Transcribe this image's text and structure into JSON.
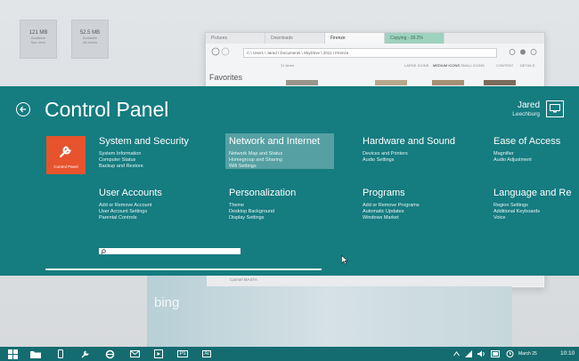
{
  "desktop": {
    "items": [
      {
        "size": "121 MB",
        "sub1": "Available",
        "sub2": "Sys drive"
      },
      {
        "size": "52.5 MB",
        "sub1": "Available",
        "sub2": "All drives"
      }
    ]
  },
  "explorer": {
    "tabs": [
      "Pictures",
      "Downloads",
      "Firenze",
      "Copying - 39.2%"
    ],
    "address": "C:\\ Users \\ Jared \\ Documents \\ SkyDrive \\ 2011 \\ Firenze",
    "favorites_label": "Favorites",
    "item_count": "31 items",
    "view_options": [
      "LARGE ICONS",
      "MEDIUM ICONS",
      "SMALL ICONS",
      "CONTENT",
      "DETAILS"
    ],
    "bing_label": "bing",
    "sidebar_item": "Carmel MASTA"
  },
  "control_panel": {
    "title": "Control Panel",
    "user_name": "Jared",
    "user_location": "Leechburg",
    "tile_label": "Control Panel",
    "categories": [
      {
        "title": "System and Security",
        "links": [
          "System Information",
          "Computer Status",
          "Backup and Restore"
        ]
      },
      {
        "title": "Network and Internet",
        "links": [
          "Network Map and Status",
          "Homegroup and Sharing",
          "Wifi Settings"
        ]
      },
      {
        "title": "Hardware and Sound",
        "links": [
          "Devices and Printers",
          "Audio Settings"
        ]
      },
      {
        "title": "Ease of Access",
        "links": [
          "Magnifier",
          "Audio Adjustment"
        ]
      },
      {
        "title": "User Accounts",
        "links": [
          "Add or Remove Account",
          "User Account Settings",
          "Parental Controls"
        ]
      },
      {
        "title": "Personalization",
        "links": [
          "Theme",
          "Desktop Background",
          "Display Settings"
        ]
      },
      {
        "title": "Programs",
        "links": [
          "Add or Remove Programs",
          "Automatic Updates",
          "Windows Market"
        ]
      },
      {
        "title": "Language and Re",
        "links": [
          "Region Settings",
          "Additional Keyboards",
          "Voice"
        ]
      }
    ]
  },
  "taskbar": {
    "apps": [
      "start-icon",
      "folder-icon",
      "phone-icon",
      "wrench-icon",
      "ie-icon",
      "mail-icon",
      "video-icon",
      "photoshop-icon",
      "illustrator-icon"
    ],
    "ps_label": "Ps",
    "ai_label": "Ai",
    "date": "March 25",
    "time": "10:10"
  },
  "colors": {
    "accent": "#157c80",
    "taskbar": "#146c70",
    "tile": "#e6532c"
  }
}
